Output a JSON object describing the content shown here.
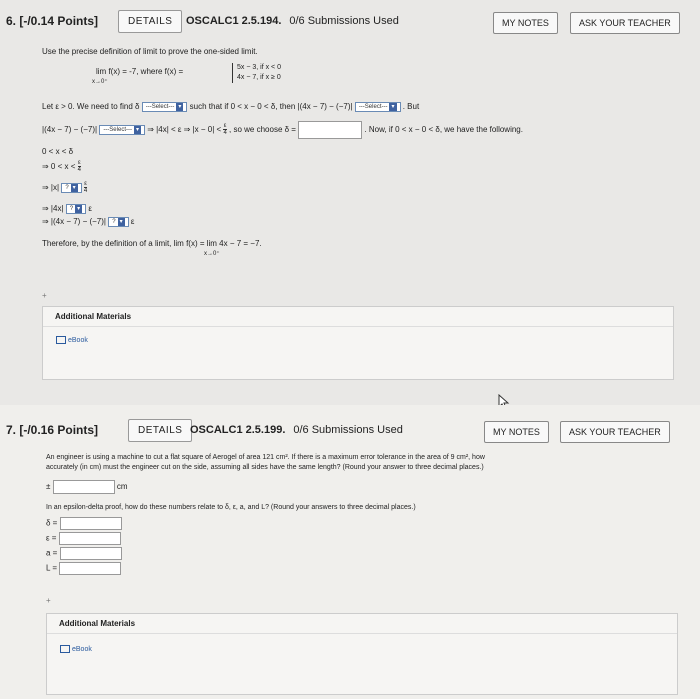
{
  "q6": {
    "number": "6. [-/0.14 Points]",
    "details": "DETAILS",
    "title": "OSCALC1 2.5.194.",
    "submissions": "0/6 Submissions Used",
    "my_notes": "MY NOTES",
    "ask_teacher": "ASK YOUR TEACHER",
    "instruction": "Use the precise definition of limit to prove the one-sided limit.",
    "lim_stmt": "lim  f(x) = -7, where f(x) =",
    "lim_sub": "x→0⁺",
    "piece1": "5x − 3,  if  x < 0",
    "piece2": "4x − 7,  if  x ≥ 0",
    "line1a": "Let ε > 0. We need to find δ",
    "line1b": "such that if 0 < x − 0 < δ, then |(4x − 7) − (−7)|",
    "line1c": ". But",
    "line2a": "|(4x − 7) − (−7)|",
    "line2b": "⇒ |4x| < ε ⇒ |x − 0| <",
    "frac_num": "ε",
    "frac_den": "4",
    "line2c": ", so we choose δ =",
    "line2d": ". Now, if 0 < x − 0 < δ, we have the following.",
    "select_label": "---Select---",
    "step1": "0 < x < δ",
    "step2": "⇒ 0 < x <",
    "step3": "⇒ |x|",
    "step4": "⇒ |4x|",
    "step5": "⇒ |(4x − 7) − (−7)|",
    "step_eps": "ε",
    "q_sel": "?",
    "conclusion": "Therefore, by the definition of a limit,  lim  f(x) =  lim  4x − 7 = −7.",
    "conc_sub": "x→0⁺",
    "additional": "Additional Materials",
    "ebook": "eBook"
  },
  "q7": {
    "number": "7. [-/0.16 Points]",
    "details": "DETAILS",
    "title": "OSCALC1 2.5.199.",
    "submissions": "0/6 Submissions Used",
    "my_notes": "MY NOTES",
    "ask_teacher": "ASK YOUR TEACHER",
    "problem1": "An engineer is using a machine to cut a flat square of Aerogel of area 121 cm². If there is a maximum error tolerance in the area of 9 cm², how",
    "problem2": "accurately (in cm) must the engineer cut on the side, assuming all sides have the same length? (Round your answer to three decimal places.)",
    "pm": "±",
    "unit": "cm",
    "relate": "In an epsilon-delta proof, how do these numbers relate to δ, ε, a, and L? (Round your answers to three decimal places.)",
    "labels": [
      "δ =",
      "ε =",
      "a =",
      "L ="
    ],
    "additional": "Additional Materials",
    "ebook": "eBook"
  }
}
